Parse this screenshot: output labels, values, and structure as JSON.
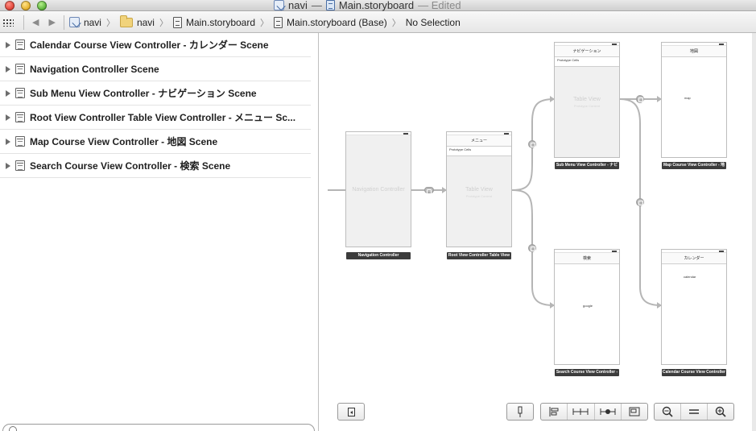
{
  "window": {
    "project": "navi",
    "separator": "—",
    "file": "Main.storyboard",
    "status": "— Edited"
  },
  "jumpbar": {
    "crumbs": [
      "navi",
      "navi",
      "Main.storyboard",
      "Main.storyboard (Base)",
      "No Selection"
    ],
    "back_glyph": "◀",
    "forward_glyph": "▶",
    "chevron": "〉"
  },
  "outline": {
    "rows": [
      "Calendar Course View Controller - カレンダー Scene",
      "Navigation Controller Scene",
      "Sub Menu View Controller - ナビゲーション Scene",
      "Root View Controller Table View Controller - メニュー Sc...",
      "Map Course View Controller - 地図 Scene",
      "Search Course View Controller - 検索 Scene"
    ]
  },
  "canvas": {
    "scenes": {
      "nav": {
        "label": "Navigation Controller",
        "title": "Navigation Controller"
      },
      "root": {
        "nav_title": "メニュー",
        "cell": "Prototype Cells",
        "tv_label": "Table View",
        "tv_sub": "Prototype Content",
        "title": "Root View Controller Table View"
      },
      "sub": {
        "nav_title": "ナビゲーション",
        "cell": "Prototype Cells",
        "tv_label": "Table View",
        "tv_sub": "Prototype Content",
        "title": "Sub Menu View Controller - ナビ"
      },
      "map": {
        "nav_title": "地図",
        "content": "map",
        "title": "Map Course View Controller - 地"
      },
      "search": {
        "nav_title": "検索",
        "content": "google",
        "title": "Search Course View Controller -"
      },
      "calendar": {
        "nav_title": "カレンダー",
        "content": "calendar",
        "title": "Calendar Course View Controller"
      }
    },
    "toolbar": {
      "zoom_out_glyph": "⊖",
      "zoom_fit_glyph": "=",
      "zoom_in_glyph": "⊕"
    }
  },
  "colors": {
    "scene_title_bg": "#3c3c3c",
    "segue_line": "#b5b5b5"
  }
}
